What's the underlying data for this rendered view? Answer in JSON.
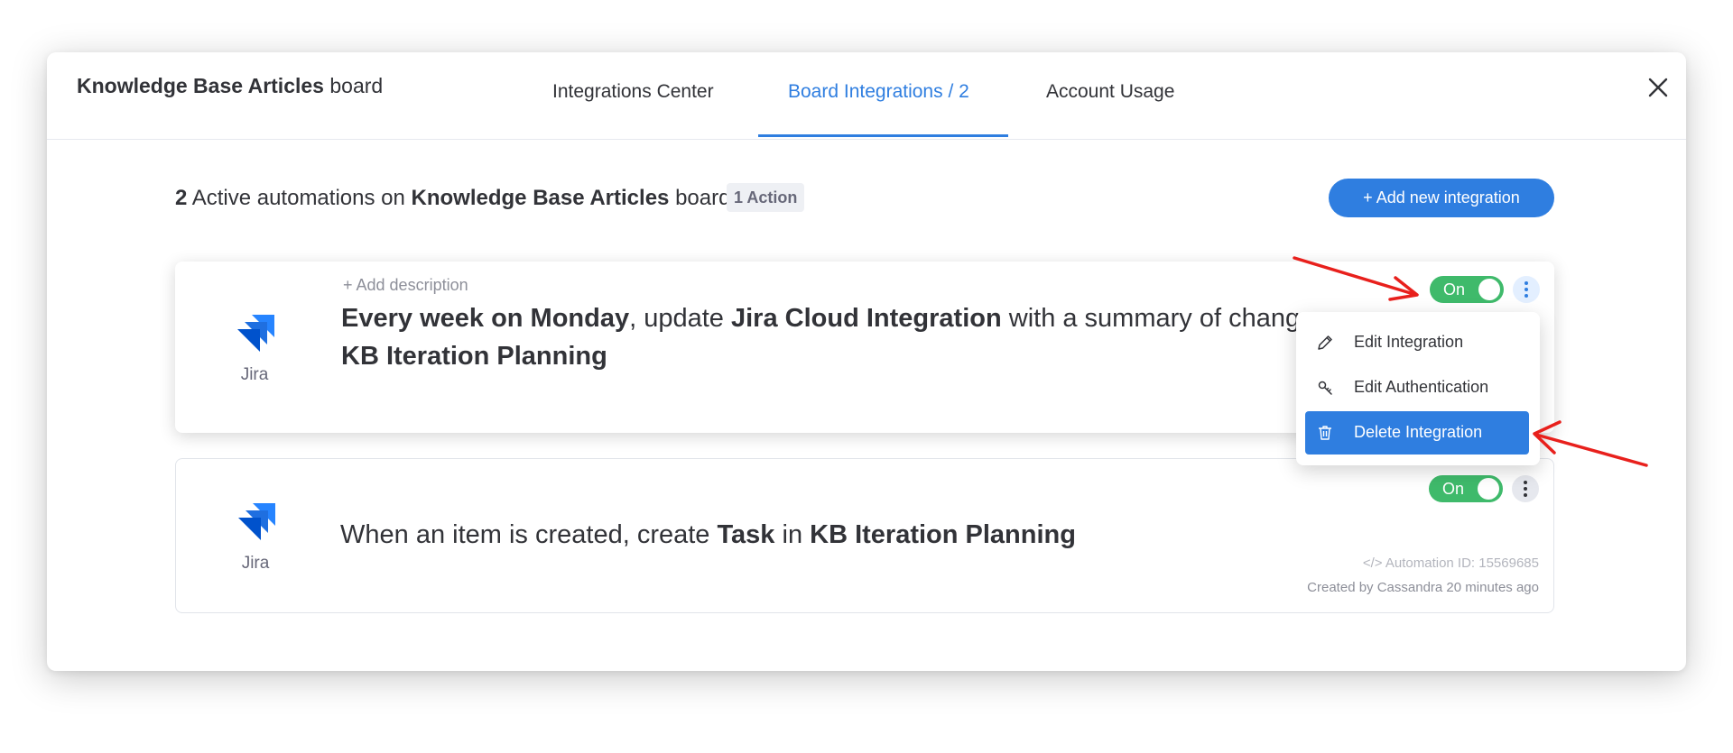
{
  "header": {
    "board_name": "Knowledge Base Articles",
    "board_suffix": "board",
    "tabs": [
      {
        "label": "Integrations Center"
      },
      {
        "label": "Board Integrations / 2"
      },
      {
        "label": "Account Usage"
      }
    ],
    "active_tab_index": 1
  },
  "summary": {
    "count": "2",
    "text": "Active automations on",
    "board_name": "Knowledge Base Articles",
    "board_suffix": "board",
    "badge": "1 Action"
  },
  "add_button": {
    "label": "+ Add new integration"
  },
  "cards": [
    {
      "app_label": "Jira",
      "add_description": "+ Add description",
      "recipe": {
        "p1": "Every week on Monday",
        "p2": ", update ",
        "p3": "Jira Cloud Integration",
        "p4": " with a summary of changes",
        "p5": "KB Iteration Planning"
      },
      "toggle_label": "On"
    },
    {
      "app_label": "Jira",
      "recipe": {
        "p1": "When an item is created, create ",
        "p2": "Task",
        "p3": " in ",
        "p4": "KB Iteration Planning"
      },
      "toggle_label": "On",
      "automation_id": "</> Automation ID: 15569685",
      "created_by": "Created by Cassandra 20 minutes ago"
    }
  ],
  "dropdown": {
    "items": [
      {
        "label": "Edit Integration",
        "icon": "pencil-icon"
      },
      {
        "label": "Edit Authentication",
        "icon": "key-icon"
      },
      {
        "label": "Delete Integration",
        "icon": "trash-icon"
      }
    ],
    "highlighted_index": 2
  },
  "colors": {
    "accent": "#2f7ee0",
    "toggle_on": "#3fba6b",
    "annotation_arrow": "#e8201c",
    "jira_blue": "#2684ff"
  }
}
